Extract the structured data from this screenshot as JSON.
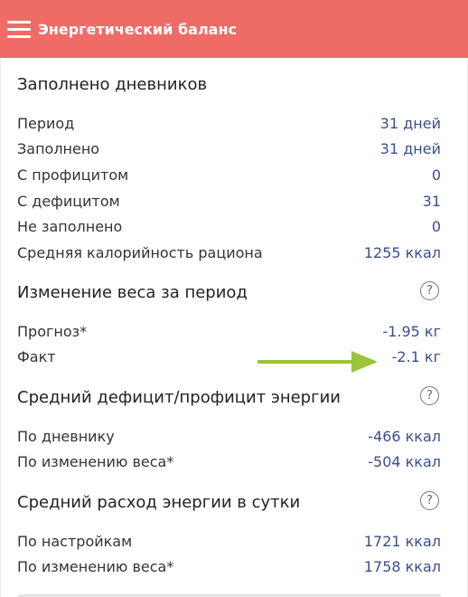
{
  "header": {
    "title": "Энергетический баланс",
    "menu_icon": "menu-icon",
    "background": "#ef6b65"
  },
  "diaries": {
    "title": "Заполнено дневников",
    "rows": [
      {
        "label": "Период",
        "value": "31 дней"
      },
      {
        "label": "Заполнено",
        "value": "31 дней"
      },
      {
        "label": "С профицитом",
        "value": "0"
      },
      {
        "label": "С дефицитом",
        "value": "31"
      },
      {
        "label": "Не заполнено",
        "value": "0"
      },
      {
        "label": "Средняя калорийность рациона",
        "value": "1255 ккал"
      }
    ]
  },
  "weight_change": {
    "title": "Изменение веса за период",
    "help": "?",
    "rows": [
      {
        "label": "Прогноз*",
        "value": "-1.95 кг"
      },
      {
        "label": "Факт",
        "value": "-2.1 кг"
      }
    ]
  },
  "avg_balance": {
    "title": "Средний дефицит/профицит энергии",
    "help": "?",
    "rows": [
      {
        "label": "По дневнику",
        "value": "-466 ккал"
      },
      {
        "label": "По изменению веса*",
        "value": "-504 ккал"
      }
    ]
  },
  "avg_expenditure": {
    "title": "Средний расход энергии в сутки",
    "help": "?",
    "rows": [
      {
        "label": "По настройкам",
        "value": "1721 ккал"
      },
      {
        "label": "По изменению веса*",
        "value": "1758 ккал"
      }
    ]
  },
  "annotation": {
    "icon": "arrow-right-icon",
    "color": "#9ac43c"
  }
}
